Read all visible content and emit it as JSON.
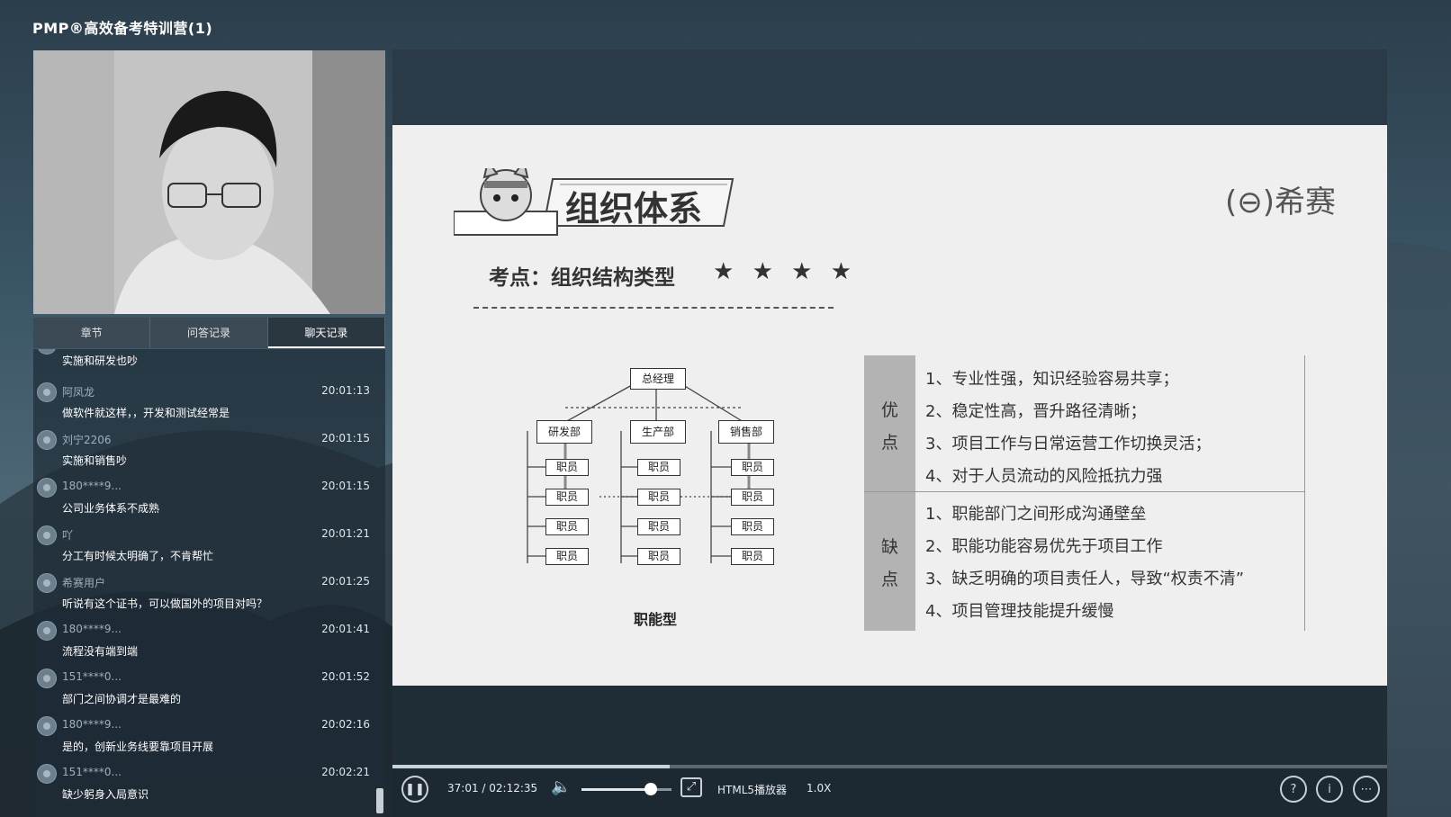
{
  "app": {
    "title": "PMP®高效备考特训营(1)"
  },
  "tabs": [
    {
      "label": "章节"
    },
    {
      "label": "问答记录"
    },
    {
      "label": "聊天记录"
    }
  ],
  "chat": {
    "partial_first_text": "实施和研发也吵",
    "messages": [
      {
        "user": "阿凤龙",
        "time": "20:01:13",
        "text": "做软件就这样，，开发和测试经常是"
      },
      {
        "user": "刘宁2206",
        "time": "20:01:15",
        "text": "实施和销售吵"
      },
      {
        "user": "180****9...",
        "time": "20:01:15",
        "text": "公司业务体系不成熟"
      },
      {
        "user": "吖",
        "time": "20:01:21",
        "text": "分工有时候太明确了，不肯帮忙"
      },
      {
        "user": "希赛用户",
        "time": "20:01:25",
        "text": "听说有这个证书，可以做国外的项目对吗？"
      },
      {
        "user": "180****9...",
        "time": "20:01:41",
        "text": "流程没有端到端"
      },
      {
        "user": "151****0...",
        "time": "20:01:52",
        "text": "部门之间协调才是最难的"
      },
      {
        "user": "180****9...",
        "time": "20:02:16",
        "text": "是的，创新业务线要靠项目开展"
      },
      {
        "user": "151****0...",
        "time": "20:02:21",
        "text": "缺少躬身入局意识"
      }
    ]
  },
  "slide": {
    "title": "组织体系",
    "brand": "希赛",
    "exam_point": "考点：组织结构类型",
    "stars": "★ ★ ★ ★",
    "org_chart": {
      "top": "总经理",
      "departments": [
        "研发部",
        "生产部",
        "销售部"
      ],
      "staff": "职员",
      "caption": "职能型"
    },
    "pros_label": "优点",
    "pros_char1": "优",
    "pros_char2": "点",
    "pros": [
      "1、专业性强，知识经验容易共享；",
      "2、稳定性高，晋升路径清晰；",
      "3、项目工作与日常运营工作切换灵活；",
      "4、对于人员流动的风险抵抗力强"
    ],
    "cons_char1": "缺",
    "cons_char2": "点",
    "cons": [
      "1、职能部门之间形成沟通壁垒",
      "2、职能功能容易优先于项目工作",
      "3、缺乏明确的项目责任人，导致“权责不清”",
      "4、项目管理技能提升缓慢"
    ]
  },
  "player": {
    "time": "37:01 / 02:12:35",
    "progress": 0.279,
    "volume": 0.76,
    "player_label": "HTML5播放器",
    "speed": "1.0X"
  }
}
